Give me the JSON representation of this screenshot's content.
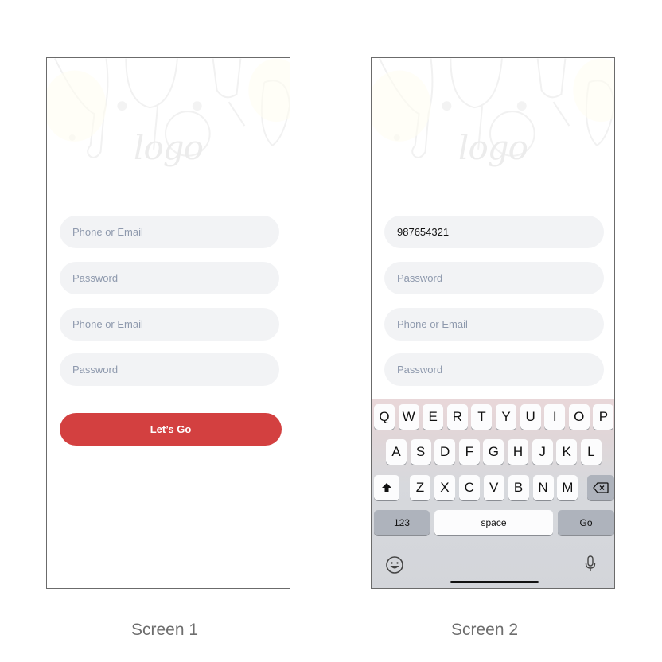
{
  "screens": [
    {
      "caption": "Screen 1",
      "logo": "logo",
      "fields": [
        {
          "placeholder": "Phone or Email",
          "value": ""
        },
        {
          "placeholder": "Password",
          "value": ""
        },
        {
          "placeholder": "Phone or Email",
          "value": ""
        },
        {
          "placeholder": "Password",
          "value": ""
        }
      ],
      "cta_label": "Let’s Go"
    },
    {
      "caption": "Screen 2",
      "logo": "logo",
      "fields": [
        {
          "placeholder": "Phone or Email",
          "value": "987654321"
        },
        {
          "placeholder": "Password",
          "value": ""
        },
        {
          "placeholder": "Phone or Email",
          "value": ""
        },
        {
          "placeholder": "Password",
          "value": ""
        }
      ],
      "keyboard": {
        "row1": [
          "Q",
          "W",
          "E",
          "R",
          "T",
          "Y",
          "U",
          "I",
          "O",
          "P"
        ],
        "row2": [
          "A",
          "S",
          "D",
          "F",
          "G",
          "H",
          "J",
          "K",
          "L"
        ],
        "row3": [
          "Z",
          "X",
          "C",
          "V",
          "B",
          "N",
          "M"
        ],
        "shift_icon": "shift-icon",
        "delete_icon": "backspace-icon",
        "numbers_label": "123",
        "space_label": "space",
        "go_label": "Go",
        "emoji_icon": "emoji-icon",
        "mic_icon": "microphone-icon"
      }
    }
  ],
  "colors": {
    "accent": "#d34040",
    "field_bg": "#f2f3f5",
    "placeholder": "#8e99ad"
  }
}
